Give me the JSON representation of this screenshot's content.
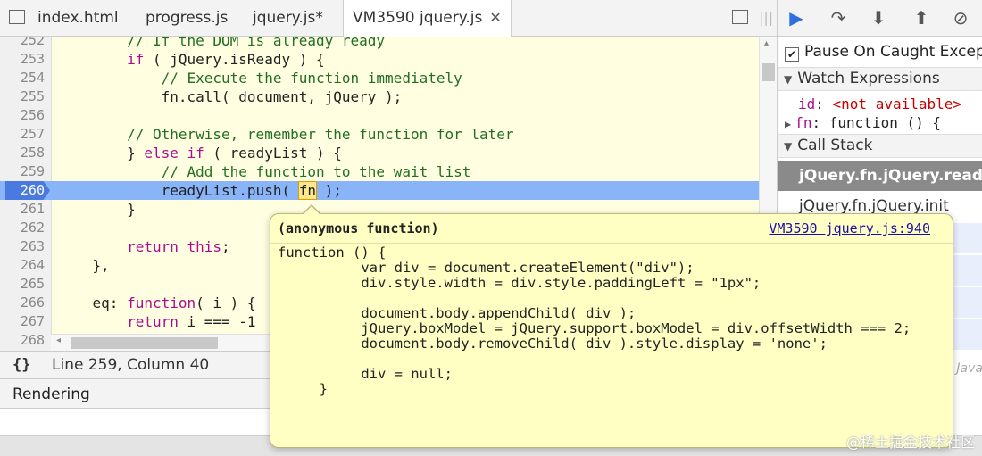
{
  "tabs": [
    {
      "label": "index.html"
    },
    {
      "label": "progress.js"
    },
    {
      "label": "jquery.js*"
    },
    {
      "label": "VM3590 jquery.js"
    }
  ],
  "tab_close": "✕",
  "code_lines": [
    {
      "num": "252",
      "segs": [
        {
          "t": "        ",
          "c": "pl"
        },
        {
          "t": "// If the DOM is already ready",
          "c": "cm"
        }
      ]
    },
    {
      "num": "253",
      "segs": [
        {
          "t": "        ",
          "c": "pl"
        },
        {
          "t": "if",
          "c": "kw"
        },
        {
          "t": " ( jQuery.isReady ) {",
          "c": "pl"
        }
      ]
    },
    {
      "num": "254",
      "segs": [
        {
          "t": "            ",
          "c": "pl"
        },
        {
          "t": "// Execute the function immediately",
          "c": "cm"
        }
      ]
    },
    {
      "num": "255",
      "segs": [
        {
          "t": "            fn.call( document, jQuery );",
          "c": "pl"
        }
      ]
    },
    {
      "num": "256",
      "segs": []
    },
    {
      "num": "257",
      "segs": [
        {
          "t": "        ",
          "c": "pl"
        },
        {
          "t": "// Otherwise, remember the function for later",
          "c": "cm"
        }
      ]
    },
    {
      "num": "258",
      "segs": [
        {
          "t": "        } ",
          "c": "pl"
        },
        {
          "t": "else if",
          "c": "kw"
        },
        {
          "t": " ( readyList ) {",
          "c": "pl"
        }
      ]
    },
    {
      "num": "259",
      "segs": [
        {
          "t": "            ",
          "c": "pl"
        },
        {
          "t": "// Add the function to the wait list",
          "c": "cm"
        }
      ]
    },
    {
      "num": "260",
      "hl": true,
      "segs": [
        {
          "t": "            readyList.push( ",
          "c": "pl"
        },
        {
          "t": "fn",
          "c": "mark"
        },
        {
          "t": " );",
          "c": "pl"
        }
      ]
    },
    {
      "num": "261",
      "segs": [
        {
          "t": "        }",
          "c": "pl"
        }
      ]
    },
    {
      "num": "262",
      "segs": []
    },
    {
      "num": "263",
      "segs": [
        {
          "t": "        ",
          "c": "pl"
        },
        {
          "t": "return this",
          "c": "kw"
        },
        {
          "t": ";",
          "c": "pl"
        }
      ]
    },
    {
      "num": "264",
      "segs": [
        {
          "t": "    },",
          "c": "pl"
        }
      ]
    },
    {
      "num": "265",
      "segs": []
    },
    {
      "num": "266",
      "segs": [
        {
          "t": "    eq: ",
          "c": "pl"
        },
        {
          "t": "function",
          "c": "kw"
        },
        {
          "t": "( i ) {",
          "c": "pl"
        }
      ]
    },
    {
      "num": "267",
      "segs": [
        {
          "t": "        ",
          "c": "pl"
        },
        {
          "t": "return",
          "c": "kw"
        },
        {
          "t": " i === -1",
          "c": "pl"
        }
      ]
    },
    {
      "num": "268",
      "segs": []
    }
  ],
  "status": {
    "braces": "{}",
    "position": "Line 259, Column 40"
  },
  "rendering_label": "Rendering",
  "debugger": {
    "pause_caught": "Pause On Caught Exceptions",
    "watch_header": "Watch Expressions",
    "watch": [
      {
        "name": "id",
        "sep": ": ",
        "value": "<not available>"
      },
      {
        "name": "fn",
        "sep": ": ",
        "value": "function () {"
      }
    ],
    "callstack_header": "Call Stack",
    "frames": [
      {
        "label": "jQuery.fn.jQuery.ready",
        "selected": true
      },
      {
        "label": "jQuery.fn.jQuery.init",
        "selected": false
      }
    ],
    "java_label": "Java"
  },
  "popover": {
    "title": "(anonymous function)",
    "link": "VM3590 jquery.js:940",
    "lines": [
      "function () {",
      "          var div = document.createElement(\"div\");",
      "          div.style.width = div.style.paddingLeft = \"1px\";",
      "",
      "          document.body.appendChild( div );",
      "          jQuery.boxModel = jQuery.support.boxModel = div.offsetWidth === 2;",
      "          document.body.removeChild( div ).style.display = 'none';",
      "",
      "          div = null;",
      "     }"
    ]
  },
  "watermark": "@稀土掘金技术社区"
}
